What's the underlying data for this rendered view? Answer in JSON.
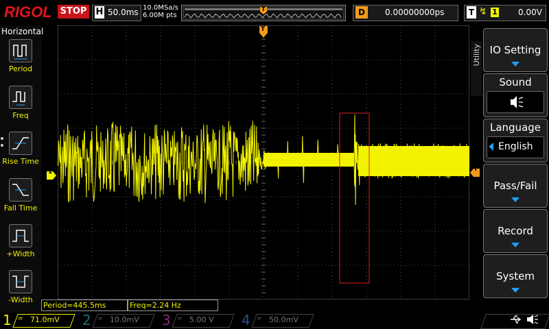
{
  "header": {
    "brand": "RIGOL",
    "run_state": "STOP",
    "timebase_label": "H",
    "timebase": "50.0ms",
    "sample_rate": "10.0MSa/s",
    "memory_depth": "6.00M pts",
    "trigger_marker": "T",
    "delay_label": "D",
    "delay": "0.00000000ps",
    "trigger_label": "T",
    "trigger_edge": "rising-edge-icon",
    "trigger_source": "1",
    "trigger_level": "0.00V"
  },
  "left_panel": {
    "title": "Horizontal",
    "items": [
      {
        "label": "Period",
        "icon": "period-icon"
      },
      {
        "label": "Freq",
        "icon": "frequency-icon"
      },
      {
        "label": "Rise Time",
        "icon": "rise-time-icon"
      },
      {
        "label": "Fall Time",
        "icon": "fall-time-icon"
      },
      {
        "label": "+Width",
        "icon": "positive-width-icon"
      },
      {
        "label": "-Width",
        "icon": "negative-width-icon"
      }
    ]
  },
  "screen": {
    "ch1_marker": "1",
    "trigger_level_marker": "T",
    "trigger_pos_marker": "T"
  },
  "right_menu": {
    "side_tab": "Utility",
    "items": [
      {
        "label": "IO Setting",
        "type": "submenu"
      },
      {
        "label": "Sound",
        "type": "toggle",
        "icon": "speaker-icon"
      },
      {
        "label": "Language",
        "type": "select",
        "value": "English"
      },
      {
        "label": "Pass/Fail",
        "type": "submenu"
      },
      {
        "label": "Record",
        "type": "submenu"
      },
      {
        "label": "System",
        "type": "submenu"
      }
    ]
  },
  "measurements": {
    "period": "Period=445.5ms",
    "freq": "Freq=2.24 Hz"
  },
  "channels": [
    {
      "num": "1",
      "coupling": "=",
      "scale": "71.0mV",
      "color": "#f3f300",
      "active": true
    },
    {
      "num": "2",
      "coupling": "=",
      "scale": "10.0mV",
      "color": "#22c8c8",
      "active": false
    },
    {
      "num": "3",
      "coupling": "=",
      "scale": "5.00 V",
      "color": "#e040e0",
      "active": false
    },
    {
      "num": "4",
      "coupling": "=",
      "scale": "50.0mV",
      "color": "#2a7bd8",
      "active": false
    }
  ],
  "status_icons": {
    "usb": "usb-icon",
    "sound": "speaker-icon"
  }
}
